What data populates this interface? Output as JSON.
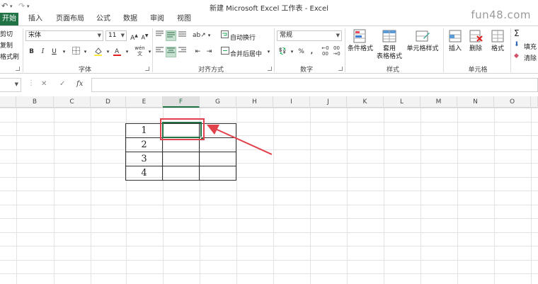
{
  "titlebar": {
    "title": "新建 Microsoft Excel 工作表 - Excel",
    "watermark": "fun48.com"
  },
  "tabs": [
    {
      "label": "开始",
      "active": true
    },
    {
      "label": "插入"
    },
    {
      "label": "页面布局"
    },
    {
      "label": "公式"
    },
    {
      "label": "数据"
    },
    {
      "label": "审阅"
    },
    {
      "label": "视图"
    }
  ],
  "clipboard": {
    "cut": "剪切",
    "copy": "复制",
    "format_painter": "格式刷"
  },
  "font": {
    "name": "宋体",
    "size": "11",
    "bold": "B",
    "italic": "I",
    "underline": "U",
    "wen": "wén",
    "group_label": "字体"
  },
  "alignment": {
    "wrap_text": "自动换行",
    "merge_center": "合并后居中",
    "group_label": "对齐方式"
  },
  "number": {
    "format": "常规",
    "percent": "%",
    "comma": ",",
    "inc_decimal": "00",
    "group_label": "数字"
  },
  "styles": {
    "conditional": "条件格式",
    "table_format_1": "套用",
    "table_format_2": "表格格式",
    "cell_styles": "单元格样式",
    "group_label": "样式"
  },
  "cells": {
    "insert": "插入",
    "delete": "删除",
    "format": "格式",
    "group_label": "单元格"
  },
  "editing": {
    "sum": "Σ",
    "fill": "填充",
    "clear": "清除"
  },
  "formula_bar": {
    "cancel": "✕",
    "enter": "✓",
    "fx": "fx",
    "value": ""
  },
  "columns": [
    "B",
    "C",
    "D",
    "E",
    "F",
    "G",
    "H",
    "I",
    "J",
    "K",
    "L",
    "M",
    "N",
    "O"
  ],
  "active_column": "F",
  "table": {
    "rows": [
      [
        "1",
        "",
        ""
      ],
      [
        "2",
        "",
        ""
      ],
      [
        "3",
        "",
        ""
      ],
      [
        "4",
        "",
        ""
      ]
    ]
  },
  "annotation_color": "#e0414a",
  "accent_color": "#217346"
}
